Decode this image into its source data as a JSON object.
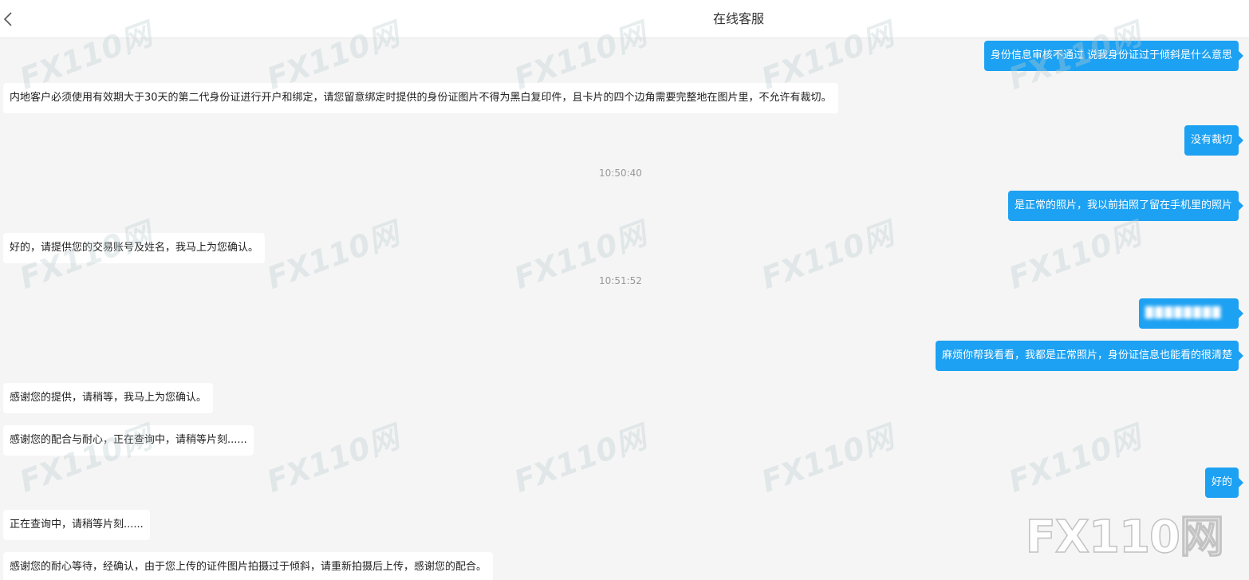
{
  "header": {
    "title": "在线客服",
    "back_icon": "chevron-left-icon"
  },
  "watermark": {
    "text": "FX110网"
  },
  "messages": [
    {
      "side": "right",
      "text": "身份信息审核不通过 说我身份证过于倾斜是什么意思"
    },
    {
      "side": "left",
      "text": "内地客户必须使用有效期大于30天的第二代身份证进行开户和绑定，请您留意绑定时提供的身份证图片不得为黑白复印件，且卡片的四个边角需要完整地在图片里，不允许有裁切。"
    },
    {
      "side": "right",
      "text": "没有裁切"
    },
    {
      "side": "time",
      "text": "10:50:40"
    },
    {
      "side": "right",
      "text": "是正常的照片，我以前拍照了留在手机里的照片"
    },
    {
      "side": "left",
      "text": "好的，请提供您的交易账号及姓名，我马上为您确认。"
    },
    {
      "side": "time",
      "text": "10:51:52"
    },
    {
      "side": "right",
      "text": "████████",
      "redacted": true
    },
    {
      "side": "right",
      "text": "麻烦你帮我看看，我都是正常照片，身份证信息也能看的很清楚"
    },
    {
      "side": "left",
      "text": "感谢您的提供，请稍等，我马上为您确认。"
    },
    {
      "side": "left",
      "text": "感谢您的配合与耐心，正在查询中，请稍等片刻......"
    },
    {
      "side": "right",
      "text": "好的"
    },
    {
      "side": "left",
      "text": "正在查询中，请稍等片刻......"
    },
    {
      "side": "left",
      "text": "感谢您的耐心等待，经确认，由于您上传的证件图片拍摄过于倾斜，请重新拍摄后上传，感谢您的配合。"
    }
  ],
  "colors": {
    "accent": "#1da1f2",
    "background": "#f5f5f5",
    "header_bg": "#ffffff",
    "timestamp": "#999999"
  }
}
